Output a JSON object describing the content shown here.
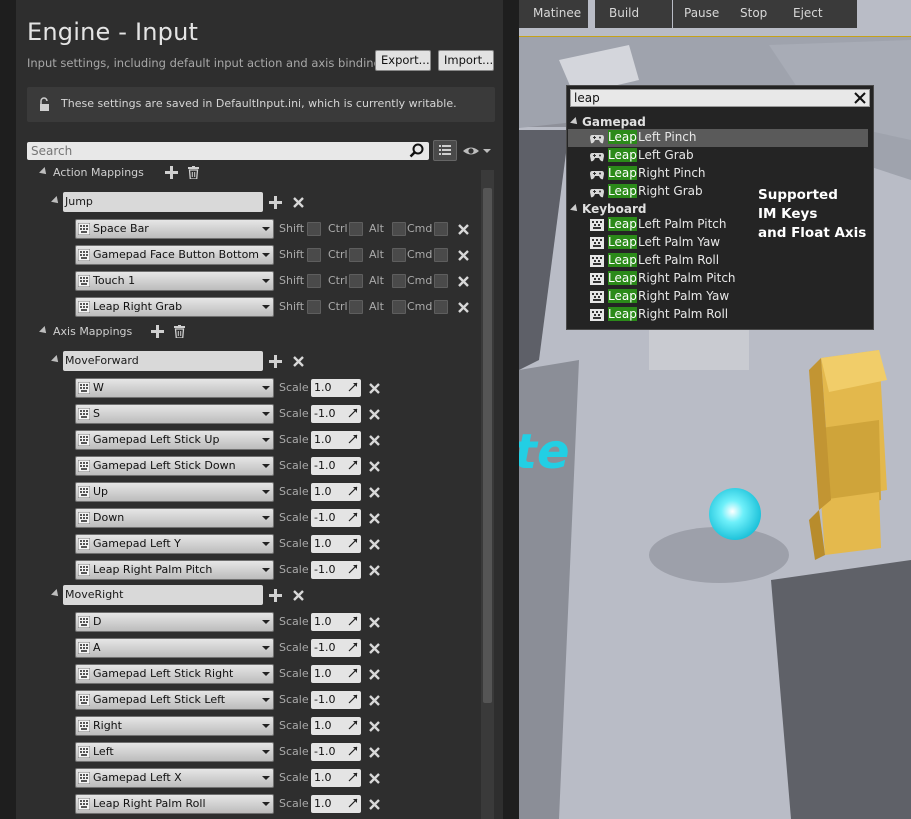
{
  "header": {
    "title": "Engine - Input",
    "subtitle": "Input settings, including default input action and axis bindings.",
    "export_label": "Export...",
    "import_label": "Import..."
  },
  "notice": {
    "text": "These settings are saved in DefaultInput.ini, which is currently writable."
  },
  "search": {
    "placeholder": "Search"
  },
  "modifiers": {
    "shift": "Shift",
    "ctrl": "Ctrl",
    "alt": "Alt",
    "cmd": "Cmd"
  },
  "scale_label": "Scale",
  "action_mappings": {
    "label": "Action Mappings",
    "actions": [
      {
        "name": "Jump",
        "keys": [
          "Space Bar",
          "Gamepad Face Button Bottom",
          "Touch 1",
          "Leap Right Grab"
        ]
      }
    ]
  },
  "axis_mappings": {
    "label": "Axis Mappings",
    "axes": [
      {
        "name": "MoveForward",
        "keys": [
          {
            "key": "W",
            "scale": "1.0"
          },
          {
            "key": "S",
            "scale": "-1.0"
          },
          {
            "key": "Gamepad Left Stick Up",
            "scale": "1.0"
          },
          {
            "key": "Gamepad Left Stick Down",
            "scale": "-1.0"
          },
          {
            "key": "Up",
            "scale": "1.0"
          },
          {
            "key": "Down",
            "scale": "-1.0"
          },
          {
            "key": "Gamepad Left Y",
            "scale": "1.0"
          },
          {
            "key": "Leap Right Palm Pitch",
            "scale": "-1.0"
          }
        ]
      },
      {
        "name": "MoveRight",
        "keys": [
          {
            "key": "D",
            "scale": "1.0"
          },
          {
            "key": "A",
            "scale": "-1.0"
          },
          {
            "key": "Gamepad Left Stick Right",
            "scale": "1.0"
          },
          {
            "key": "Gamepad Left Stick Left",
            "scale": "-1.0"
          },
          {
            "key": "Right",
            "scale": "1.0"
          },
          {
            "key": "Left",
            "scale": "-1.0"
          },
          {
            "key": "Gamepad Left X",
            "scale": "1.0"
          },
          {
            "key": "Leap Right Palm Roll",
            "scale": "1.0"
          }
        ]
      }
    ]
  },
  "viewport_toolbar": {
    "buttons": [
      "Matinee",
      "Build",
      "Pause",
      "Stop",
      "Eject"
    ]
  },
  "key_picker": {
    "query": "leap",
    "highlight": "Leap",
    "categories": [
      {
        "name": "Gamepad",
        "icon": "gamepad-icon",
        "items": [
          "Left Pinch",
          "Left Grab",
          "Right Pinch",
          "Right Grab"
        ],
        "selected": 0
      },
      {
        "name": "Keyboard",
        "icon": "keyboard-icon",
        "items": [
          "Left Palm Pitch",
          "Left Palm Yaw",
          "Left Palm Roll",
          "Right Palm Pitch",
          "Right Palm Yaw",
          "Right Palm Roll"
        ],
        "selected": -1
      }
    ]
  },
  "annotation": {
    "lines": [
      "Supported",
      "IM Keys",
      "and Float Axis"
    ]
  },
  "colors": {
    "panel_bg": "#2e2e2e",
    "highlight_green": "#2b8a19",
    "viewport_floor": "#b8bcc6",
    "crate_yellow": "#e5b74a",
    "sphere_cyan": "#1fd5e6"
  }
}
